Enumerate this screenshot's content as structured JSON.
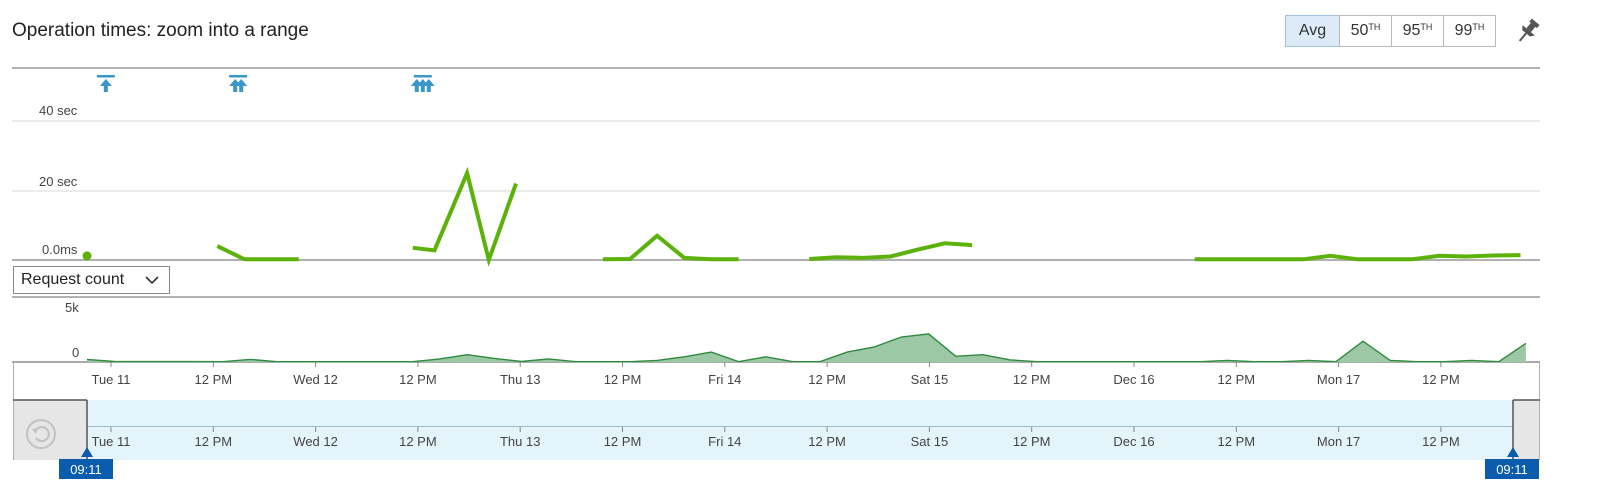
{
  "header": {
    "title": "Operation times: zoom into a range",
    "aggregations": [
      {
        "label": "Avg",
        "sup": "",
        "active": true
      },
      {
        "label": "50",
        "sup": "TH",
        "active": false
      },
      {
        "label": "95",
        "sup": "TH",
        "active": false
      },
      {
        "label": "99",
        "sup": "TH",
        "active": false
      }
    ],
    "pin_icon": "pin-icon"
  },
  "metric_selector": {
    "value": "Request count",
    "icon": "chevron-down-icon"
  },
  "brush": {
    "start_time": "09:11",
    "end_time": "09:11",
    "reset_icon": "reset-zoom-icon"
  },
  "colors": {
    "line": "#5cb20a",
    "area_fill": "#9cc8a6",
    "area_stroke": "#2e8b3e",
    "accent": "#0b5cad",
    "marker": "#3a98c9"
  },
  "chart_data": [
    {
      "type": "line",
      "name": "operation-times",
      "ylabels": [
        "40 sec",
        "20 sec",
        "0.0ms"
      ],
      "ylim": [
        0,
        40
      ],
      "yunit": "sec",
      "x_ticks": [
        "Tue 11",
        "12 PM",
        "Wed 12",
        "12 PM",
        "Thu 13",
        "12 PM",
        "Fri 14",
        "12 PM",
        "Sat 15",
        "12 PM",
        "Dec 16",
        "12 PM",
        "Mon 17",
        "12 PM"
      ],
      "x_range_hours": [
        0,
        132
      ],
      "deployment_markers_hours": [
        1,
        13,
        30
      ],
      "segments": [
        {
          "x": [
            0
          ],
          "y": [
            0.6
          ]
        },
        {
          "x": [
            12,
            14.5,
            19.5
          ],
          "y": [
            4,
            0.2,
            0.2
          ]
        },
        {
          "x": [
            30,
            32,
            35,
            37,
            39.5
          ],
          "y": [
            3.5,
            2.8,
            25,
            0,
            22
          ]
        },
        {
          "x": [
            47.5,
            50,
            52.5,
            55,
            57.5,
            60
          ],
          "y": [
            0.2,
            0.3,
            7,
            0.6,
            0.2,
            0.2
          ]
        },
        {
          "x": [
            66.5,
            69,
            71.5,
            74,
            76.5,
            79,
            81.5
          ],
          "y": [
            0.3,
            0.8,
            0.6,
            1.0,
            3,
            4.8,
            4.3
          ]
        },
        {
          "x": [
            102,
            104.5,
            107,
            109.5,
            112,
            114.5,
            117,
            119.5,
            122,
            124.5,
            127,
            129.5,
            132
          ],
          "y": [
            0.2,
            0.2,
            0.2,
            0.2,
            0.2,
            1.2,
            0.2,
            0.2,
            0.2,
            1.2,
            1.0,
            1.3,
            1.4
          ]
        }
      ]
    },
    {
      "type": "area",
      "name": "request-count",
      "ylabels": [
        "5k",
        "0"
      ],
      "ylim": [
        0,
        5000
      ],
      "x": [
        0,
        2.5,
        5,
        7.5,
        10,
        12.5,
        15,
        17.5,
        20,
        22.5,
        25,
        27.5,
        30,
        32.5,
        35,
        37.5,
        40,
        42.5,
        45,
        47.5,
        50,
        52.5,
        55,
        57.5,
        60,
        62.5,
        65,
        67.5,
        70,
        72.5,
        75,
        77.5,
        80,
        82.5,
        85,
        87.5,
        90,
        92.5,
        95,
        97.5,
        100,
        102.5,
        105,
        107.5,
        110,
        112.5,
        115,
        117.5,
        120,
        122.5,
        125,
        127.5,
        130,
        132.5
      ],
      "values": [
        250,
        50,
        40,
        40,
        40,
        30,
        250,
        30,
        30,
        30,
        30,
        30,
        30,
        300,
        700,
        350,
        50,
        300,
        30,
        30,
        30,
        150,
        500,
        950,
        30,
        500,
        30,
        30,
        950,
        1450,
        2400,
        2700,
        550,
        700,
        200,
        30,
        30,
        30,
        30,
        30,
        30,
        30,
        150,
        30,
        30,
        150,
        30,
        2000,
        150,
        30,
        30,
        150,
        30,
        1800,
        1200,
        50,
        300
      ]
    }
  ],
  "navigator": {
    "x_ticks": [
      "Tue 11",
      "12 PM",
      "Wed 12",
      "12 PM",
      "Thu 13",
      "12 PM",
      "Fri 14",
      "12 PM",
      "Sat 15",
      "12 PM",
      "Dec 16",
      "12 PM",
      "Mon 17",
      "12 PM"
    ]
  }
}
